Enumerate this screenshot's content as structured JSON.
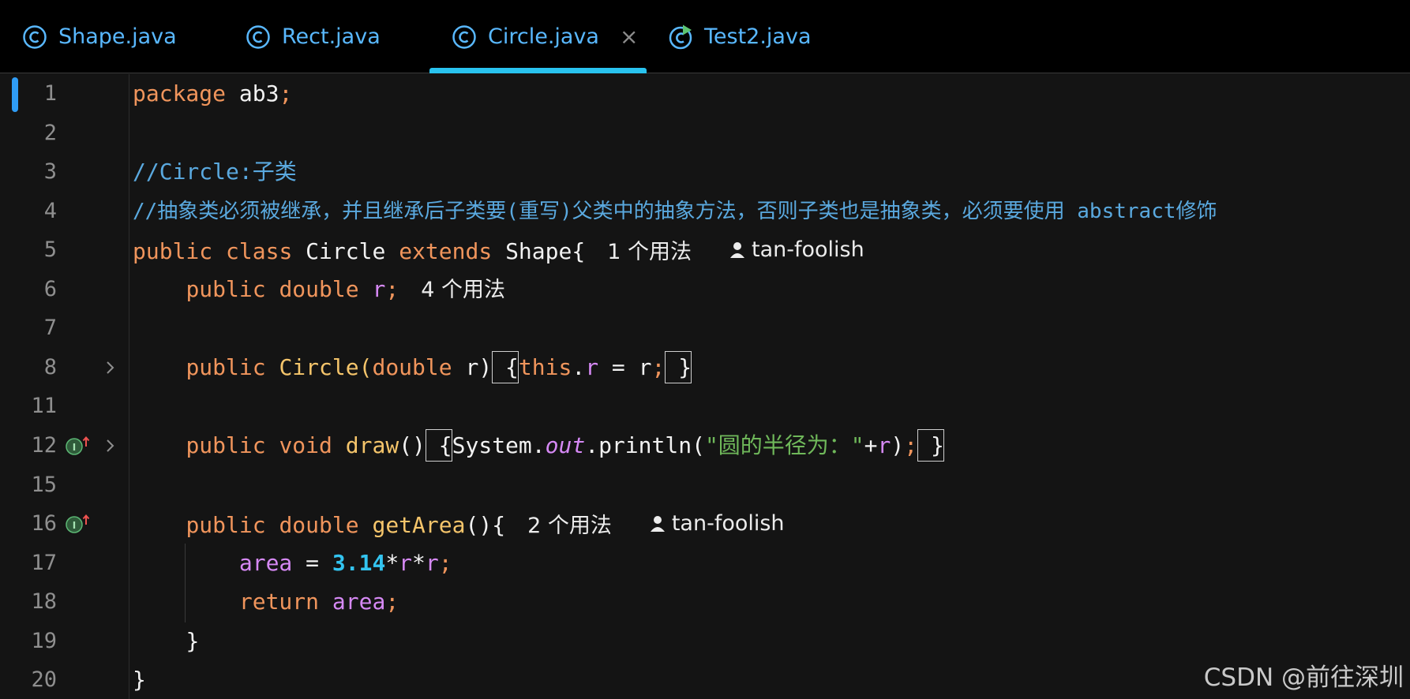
{
  "tabs": [
    {
      "label": "Shape.java",
      "active": false
    },
    {
      "label": "Rect.java",
      "active": false
    },
    {
      "label": "Circle.java",
      "active": true,
      "close": "×"
    },
    {
      "label": "Test2.java",
      "active": false
    }
  ],
  "editor": {
    "lines": [
      {
        "num": "1"
      },
      {
        "num": "2"
      },
      {
        "num": "3"
      },
      {
        "num": "4"
      },
      {
        "num": "5"
      },
      {
        "num": "6"
      },
      {
        "num": "7"
      },
      {
        "num": "8"
      },
      {
        "num": "11"
      },
      {
        "num": "12"
      },
      {
        "num": "15"
      },
      {
        "num": "16"
      },
      {
        "num": "17"
      },
      {
        "num": "18"
      },
      {
        "num": "19"
      },
      {
        "num": "20"
      }
    ],
    "code": {
      "l1_kw": "package",
      "l1_pkg": " ab3",
      "l1_semi": ";",
      "l3_comment": "//Circle:子类",
      "l4_comment": "//抽象类必须被继承，并且继承后子类要(重写)父类中的抽象方法，否则子类也是抽象类，必须要使用 abstract修饰",
      "l5_kw1": "public",
      "l5_kw2": "class",
      "l5_name": "Circle",
      "l5_kw3": "extends",
      "l5_super": "Shape{",
      "l5_hint": "1 个用法",
      "l5_author": "tan-foolish",
      "l6_kw1": "public",
      "l6_kw2": "double",
      "l6_field": "r",
      "l6_semi": ";",
      "l6_hint": "4 个用法",
      "l8_kw1": "public",
      "l8_fn": "Circle",
      "l8_open": "(",
      "l8_kw2": "double",
      "l8_param": " r",
      "l8_close": ")",
      "l8_lbrace": " {",
      "l8_this": "this",
      "l8_dot": ".",
      "l8_field": "r",
      "l8_assign": " = r",
      "l8_semi": ";",
      "l8_rbrace": " }",
      "l12_kw1": "public",
      "l12_kw2": "void",
      "l12_fn": "draw",
      "l12_parens": "()",
      "l12_lbrace": " {",
      "l12_sys": "System.",
      "l12_out": "out",
      "l12_print": ".println(",
      "l12_str": "\"圆的半径为：\"",
      "l12_plus": "+",
      "l12_r": "r",
      "l12_close": ")",
      "l12_semi": ";",
      "l12_rbrace": " }",
      "l16_kw1": "public",
      "l16_kw2": "double",
      "l16_fn": "getArea",
      "l16_rest": "(){",
      "l16_hint": "2 个用法",
      "l16_author": "tan-foolish",
      "l17_area": "area",
      "l17_eq": " = ",
      "l17_num": "3.14",
      "l17_mul1": "*",
      "l17_r1": "r",
      "l17_mul2": "*",
      "l17_r2": "r",
      "l17_semi": ";",
      "l18_kw": "return",
      "l18_area": "area",
      "l18_semi": ";",
      "l19_brace": "}",
      "l20_brace": "}"
    }
  },
  "watermark": "CSDN @前往深圳",
  "colors": {
    "keyword": "#f0955c",
    "comment": "#5aa9df",
    "function": "#f5c56b",
    "field": "#d689f5",
    "number": "#33c4f0",
    "string": "#6fb85a",
    "tab_text": "#59b8ff",
    "tab_underline": "#29c3ef"
  },
  "icons": [
    "java-class-icon",
    "java-class-run-icon",
    "close-icon",
    "chevron-right-icon",
    "implements-override-icon",
    "user-icon"
  ]
}
